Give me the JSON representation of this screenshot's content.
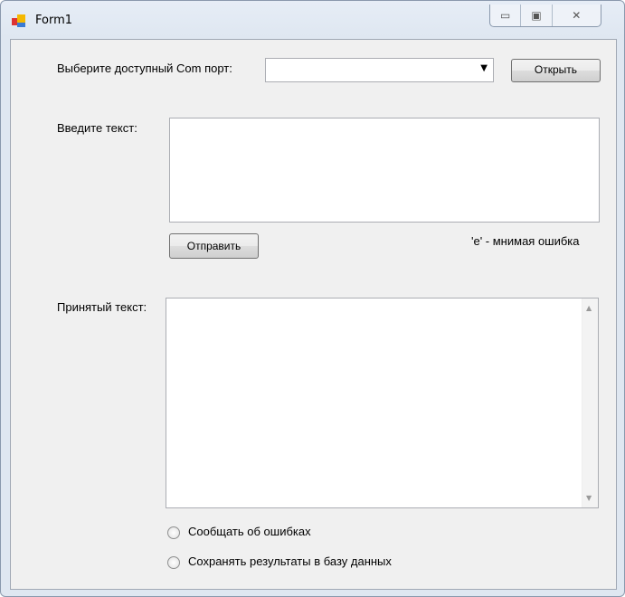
{
  "window": {
    "title": "Form1",
    "min_icon": "▭",
    "max_icon": "▣",
    "close_icon": "✕"
  },
  "com": {
    "label": "Выберите доступный Com порт:",
    "value": "",
    "open_button": "Открыть"
  },
  "input": {
    "label": "Введите текст:",
    "value": "",
    "send_button": "Отправить",
    "note": "'e' - мнимая ошибка"
  },
  "received": {
    "label": "Принятый текст:",
    "value": ""
  },
  "options": [
    {
      "label": "Сообщать об ошибках",
      "checked": false
    },
    {
      "label": "Сохранять результаты в базу данных",
      "checked": false
    }
  ]
}
